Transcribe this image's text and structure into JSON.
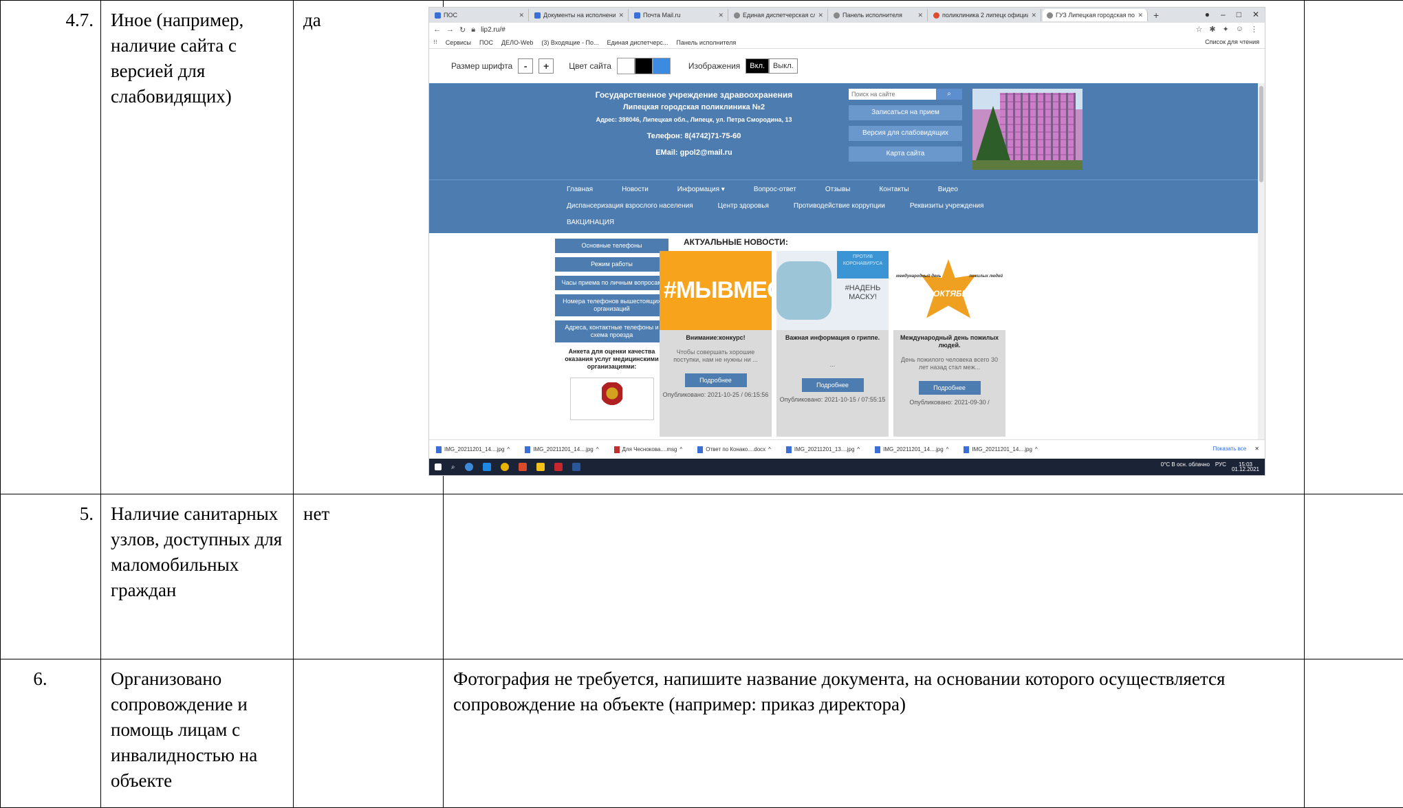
{
  "rows": [
    {
      "num": "4.7.",
      "label": "Иное (например, наличие сайта с версией для слабовидящих)",
      "value": "да",
      "evidence": ""
    },
    {
      "num": "5.",
      "label": "Наличие санитарных узлов, доступных для маломобильных граждан",
      "value": "нет",
      "evidence": ""
    },
    {
      "num": "6.",
      "label": "Организовано сопровождение и помощь лицам с инвалидностью на объекте",
      "value": "",
      "evidence": "Фотография не требуется, напишите название документа, на основании которого осуществляется сопровождение на объекте (например: приказ директора)"
    }
  ],
  "screenshot": {
    "tabs": [
      {
        "label": "ПОС",
        "icon": "blue"
      },
      {
        "label": "Документы на исполнении",
        "icon": "blue"
      },
      {
        "label": "Почта Mail.ru",
        "icon": "blue"
      },
      {
        "label": "Единая диспетчерская служба",
        "icon": "grey"
      },
      {
        "label": "Панель исполнителя",
        "icon": "grey"
      },
      {
        "label": "поликлиника 2 липецк официал",
        "icon": "red"
      },
      {
        "label": "ГУЗ Липецкая городская поли",
        "icon": "grey",
        "active": true
      }
    ],
    "url": "lip2.ru/#",
    "bookmarks": [
      "Сервисы",
      "ПОС",
      "ДЕЛО-Web",
      "(3) Входящие - По...",
      "Единая диспетчерс...",
      "Панель исполнителя"
    ],
    "bookmarks_right": "Список для чтения",
    "a11y": {
      "font_label": "Размер шрифта",
      "minus": "-",
      "plus": "+",
      "color_label": "Цвет сайта",
      "images_label": "Изображения",
      "on": "Вкл.",
      "off": "Выкл."
    },
    "header": {
      "line1": "Государственное учреждение здравоохранения",
      "line2": "Липецкая городская поликлиника №2",
      "line3": "Адрес: 398046, Липецкая обл., Липецк, ул. Петра Смородина, 13",
      "line4": "Телефон: 8(4742)71-75-60",
      "line5": "EMail: gpol2@mail.ru",
      "search_placeholder": "Поиск на сайте",
      "search_icon": "magnifier-icon",
      "btn_appointment": "Записаться на прием",
      "btn_lowvision": "Версия для слабовидящих",
      "btn_sitemap": "Карта сайта"
    },
    "nav": {
      "row1": [
        "Главная",
        "Новости",
        "Информация ▾",
        "Вопрос-ответ",
        "Отзывы",
        "Контакты",
        "Видео"
      ],
      "row2": [
        "Диспансеризация взрослого населения",
        "Центр здоровья",
        "Противодействие коррупции",
        "Реквизиты учреждения"
      ],
      "row3": [
        "ВАКЦИНАЦИЯ"
      ]
    },
    "left_menu": [
      "Основные телефоны",
      "Режим работы",
      "Часы приема по личным вопросам",
      "Номера телефонов вышестоящих организаций",
      "Адреса, контактные телефоны и схема проезда"
    ],
    "survey": "Анкета для оценки качества оказания услуг медицинскими организациями:",
    "news_title": "АКТУАЛЬНЫЕ НОВОСТИ:",
    "news": [
      {
        "image_text": "#МЫВМЕСТЕ",
        "title": "Внимание:конкурс!",
        "desc": "Чтобы совершать хорошие поступки, нам не нужны ни ...",
        "more": "Подробнее",
        "date": "Опубликовано: 2021-10-25 / 06:15:56"
      },
      {
        "image_text": "#НАДЕНЬ МАСКУ!",
        "tag": "ПРОТИВ КОРОНАВИРУСА",
        "title": "Важная информация о гриппе.",
        "desc": "...",
        "more": "Подробнее",
        "date": "Опубликовано: 2021-10-15 / 07:55:15"
      },
      {
        "image_text": "1 ОКТЯБРЯ",
        "side_left": "международный день",
        "side_right": "пожилых людей",
        "title": "Международный день пожилых людей.",
        "desc": "День пожилого человека всего 30 лет назад стал меж...",
        "more": "Подробнее",
        "date": "Опубликовано: 2021-09-30 /"
      }
    ],
    "downloads": [
      {
        "name": "IMG_20211201_14....jpg",
        "icon": "blue"
      },
      {
        "name": "IMG_20211201_14....jpg",
        "icon": "blue"
      },
      {
        "name": "Для Чеснокова....msg",
        "icon": "red"
      },
      {
        "name": "Ответ по Конако....docx",
        "icon": "blue"
      },
      {
        "name": "IMG_20211201_13....jpg",
        "icon": "blue"
      },
      {
        "name": "IMG_20211201_14....jpg",
        "icon": "blue"
      },
      {
        "name": "IMG_20211201_14....jpg",
        "icon": "blue"
      }
    ],
    "downloads_show_all": "Показать все",
    "tray": {
      "weather": "0°C В осн. облачно",
      "lang": "РУС",
      "time": "15:03",
      "date": "01.12.2021"
    }
  }
}
